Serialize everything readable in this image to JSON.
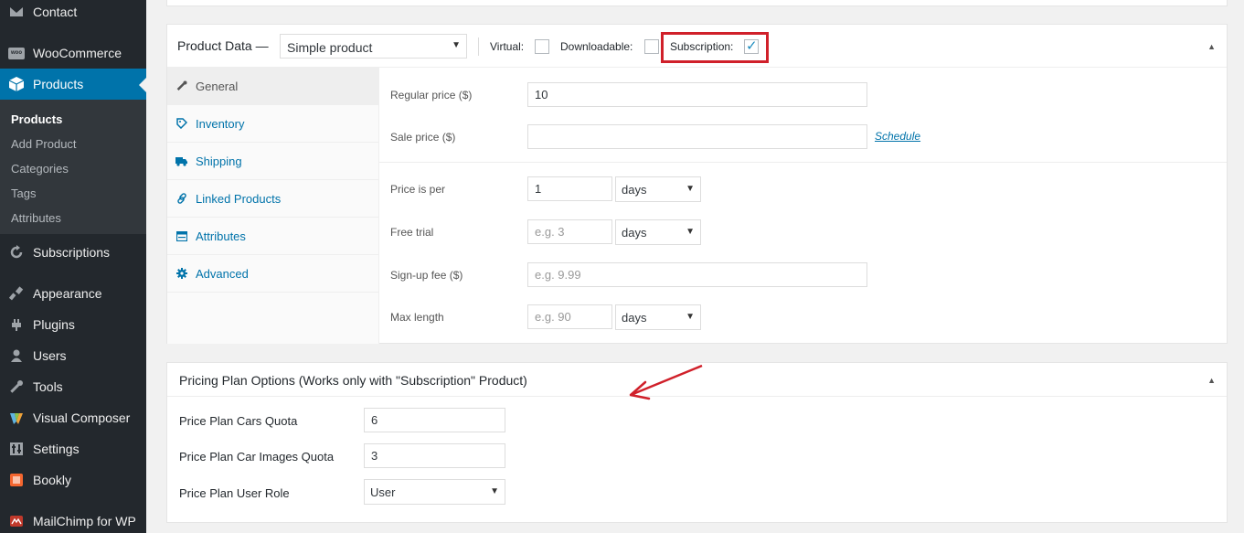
{
  "sidebar": {
    "items": [
      {
        "label": "Contact",
        "icon": "contact-icon"
      },
      {
        "label": "WooCommerce",
        "icon": "woocommerce-icon"
      },
      {
        "label": "Products",
        "icon": "products-icon"
      },
      {
        "label": "Subscriptions",
        "icon": "subscriptions-icon"
      },
      {
        "label": "Appearance",
        "icon": "appearance-icon"
      },
      {
        "label": "Plugins",
        "icon": "plugins-icon"
      },
      {
        "label": "Users",
        "icon": "users-icon"
      },
      {
        "label": "Tools",
        "icon": "tools-icon"
      },
      {
        "label": "Visual Composer",
        "icon": "visual-composer-icon"
      },
      {
        "label": "Settings",
        "icon": "settings-icon"
      },
      {
        "label": "Bookly",
        "icon": "bookly-icon"
      },
      {
        "label": "MailChimp for WP",
        "icon": "mailchimp-icon"
      }
    ],
    "submenu": [
      "Products",
      "Add Product",
      "Categories",
      "Tags",
      "Attributes"
    ],
    "woo_badge": "woo"
  },
  "product_data": {
    "title": "Product Data —",
    "type_selected": "Simple product",
    "virtual_label": "Virtual:",
    "downloadable_label": "Downloadable:",
    "subscription_label": "Subscription:",
    "subscription_checked": true,
    "tabs": [
      {
        "label": "General",
        "icon": "wrench-icon"
      },
      {
        "label": "Inventory",
        "icon": "tag-icon"
      },
      {
        "label": "Shipping",
        "icon": "truck-icon"
      },
      {
        "label": "Linked Products",
        "icon": "link-icon"
      },
      {
        "label": "Attributes",
        "icon": "list-icon"
      },
      {
        "label": "Advanced",
        "icon": "gear-icon"
      }
    ],
    "fields": {
      "regular_price_label": "Regular price ($)",
      "regular_price_value": "10",
      "sale_price_label": "Sale price ($)",
      "sale_price_value": "",
      "schedule_link": "Schedule",
      "price_per_label": "Price is per",
      "price_per_value": "1",
      "price_per_unit": "days",
      "free_trial_label": "Free trial",
      "free_trial_placeholder": "e.g. 3",
      "free_trial_unit": "days",
      "signup_fee_label": "Sign-up fee ($)",
      "signup_fee_placeholder": "e.g. 9.99",
      "max_length_label": "Max length",
      "max_length_placeholder": "e.g. 90",
      "max_length_unit": "days"
    }
  },
  "pricing_plan": {
    "title": "Pricing Plan Options (Works only with \"Subscription\" Product)",
    "cars_quota_label": "Price Plan Cars Quota",
    "cars_quota_value": "6",
    "images_quota_label": "Price Plan Car Images Quota",
    "images_quota_value": "3",
    "user_role_label": "Price Plan User Role",
    "user_role_value": "User"
  },
  "colors": {
    "sidebar_bg": "#23282d",
    "active_bg": "#0073aa",
    "highlight_red": "#d0202a",
    "link_blue": "#0073aa"
  }
}
